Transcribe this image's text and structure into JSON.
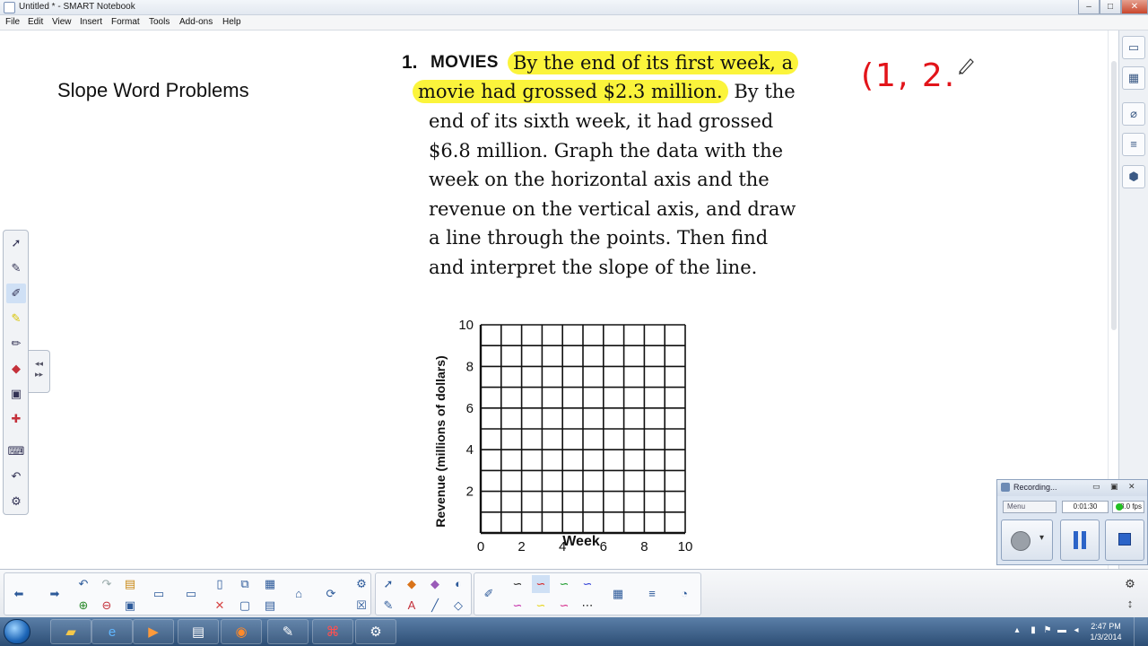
{
  "window": {
    "title": "Untitled * - SMART Notebook",
    "minimize": "–",
    "maximize": "□",
    "close": "✕"
  },
  "menu": [
    "File",
    "Edit",
    "View",
    "Insert",
    "Format",
    "Tools",
    "Add-ons",
    "Help"
  ],
  "page": {
    "title": "Slope Word Problems",
    "problem": {
      "number": "1.",
      "label": "MOVIES",
      "highlight1": "By the end of its first week, a",
      "highlight2": "movie had grossed $2.3 million.",
      "after_highlight2": " By the",
      "lines": [
        "end of its sixth week, it had grossed",
        "$6.8 million. Graph the data with the",
        "week on the horizontal axis and the",
        "revenue on the vertical axis, and draw",
        "a line through the points. Then find",
        "and interpret the slope of the line."
      ]
    },
    "handwriting": "(1, 2.",
    "graph": {
      "ylabel": "Revenue (millions of dollars)",
      "xlabel": "Week",
      "y_ticks": [
        "10",
        "8",
        "6",
        "4",
        "2"
      ],
      "x_ticks": [
        "0",
        "2",
        "4",
        "6",
        "8",
        "10"
      ]
    }
  },
  "chart_data": {
    "type": "scatter",
    "title": "",
    "xlabel": "Week",
    "ylabel": "Revenue (millions of dollars)",
    "xlim": [
      0,
      10
    ],
    "ylim": [
      0,
      10
    ],
    "x_ticks": [
      0,
      2,
      4,
      6,
      8,
      10
    ],
    "y_ticks": [
      2,
      4,
      6,
      8,
      10
    ],
    "grid": true,
    "series": []
  },
  "recorder": {
    "title": "Recording...",
    "menu": "Menu",
    "time": "0:01:30",
    "fps": "8.0 fps"
  },
  "taskbar": {
    "time": "2:47 PM",
    "date": "1/3/2014"
  },
  "colors": {
    "highlight": "#fbf43b",
    "ink": "#e2141a",
    "taskbar": "#2c4d74"
  },
  "icons": {
    "sidebar": [
      "page-sorter-icon",
      "gallery-icon",
      "attachments-icon",
      "properties-icon",
      "addons-icon"
    ],
    "pen_tools": [
      "select-icon",
      "magic-pen-icon",
      "pen-icon",
      "highlighter-icon",
      "creative-pen-icon",
      "eraser-icon",
      "fill-icon",
      "shapes-icon",
      "keyboard-icon",
      "undo-icon"
    ]
  }
}
